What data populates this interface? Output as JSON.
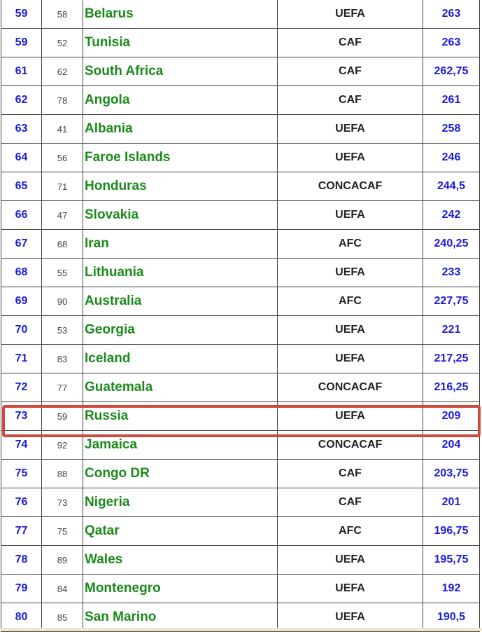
{
  "rows": [
    {
      "rank": "59",
      "prev": "58",
      "team": "Belarus",
      "conf": "UEFA",
      "points": "263"
    },
    {
      "rank": "59",
      "prev": "52",
      "team": "Tunisia",
      "conf": "CAF",
      "points": "263"
    },
    {
      "rank": "61",
      "prev": "62",
      "team": "South Africa",
      "conf": "CAF",
      "points": "262,75"
    },
    {
      "rank": "62",
      "prev": "78",
      "team": "Angola",
      "conf": "CAF",
      "points": "261"
    },
    {
      "rank": "63",
      "prev": "41",
      "team": "Albania",
      "conf": "UEFA",
      "points": "258"
    },
    {
      "rank": "64",
      "prev": "56",
      "team": "Faroe Islands",
      "conf": "UEFA",
      "points": "246"
    },
    {
      "rank": "65",
      "prev": "71",
      "team": "Honduras",
      "conf": "CONCACAF",
      "points": "244,5"
    },
    {
      "rank": "66",
      "prev": "47",
      "team": "Slovakia",
      "conf": "UEFA",
      "points": "242"
    },
    {
      "rank": "67",
      "prev": "68",
      "team": "Iran",
      "conf": "AFC",
      "points": "240,25"
    },
    {
      "rank": "68",
      "prev": "55",
      "team": "Lithuania",
      "conf": "UEFA",
      "points": "233"
    },
    {
      "rank": "69",
      "prev": "90",
      "team": "Australia",
      "conf": "AFC",
      "points": "227,75"
    },
    {
      "rank": "70",
      "prev": "53",
      "team": "Georgia",
      "conf": "UEFA",
      "points": "221"
    },
    {
      "rank": "71",
      "prev": "83",
      "team": "Iceland",
      "conf": "UEFA",
      "points": "217,25"
    },
    {
      "rank": "72",
      "prev": "77",
      "team": "Guatemala",
      "conf": "CONCACAF",
      "points": "216,25"
    },
    {
      "rank": "73",
      "prev": "59",
      "team": "Russia",
      "conf": "UEFA",
      "points": "209"
    },
    {
      "rank": "74",
      "prev": "92",
      "team": "Jamaica",
      "conf": "CONCACAF",
      "points": "204"
    },
    {
      "rank": "75",
      "prev": "88",
      "team": "Congo DR",
      "conf": "CAF",
      "points": "203,75"
    },
    {
      "rank": "76",
      "prev": "73",
      "team": "Nigeria",
      "conf": "CAF",
      "points": "201"
    },
    {
      "rank": "77",
      "prev": "75",
      "team": "Qatar",
      "conf": "AFC",
      "points": "196,75"
    },
    {
      "rank": "78",
      "prev": "89",
      "team": "Wales",
      "conf": "UEFA",
      "points": "195,75"
    },
    {
      "rank": "79",
      "prev": "84",
      "team": "Montenegro",
      "conf": "UEFA",
      "points": "192"
    },
    {
      "rank": "80",
      "prev": "85",
      "team": "San Marino",
      "conf": "UEFA",
      "points": "190,5"
    }
  ],
  "highlighted_team": "Russia",
  "colors": {
    "rank": "#1a1adb",
    "team": "#1b8a1b",
    "highlight": "#cd4a3c"
  }
}
